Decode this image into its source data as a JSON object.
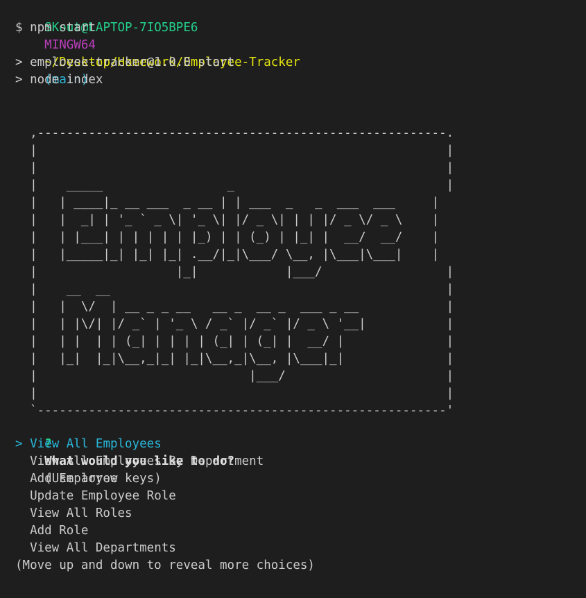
{
  "prompt": {
    "user_host": "SKout@LAPTOP-7IO5BPE6",
    "shell": "MINGW64",
    "path": "~/Desktop/Homework/Employee-Tracker",
    "branch": "(main)",
    "symbol": "$",
    "command": "npm start"
  },
  "npm_output": [
    "> employee-tracker@1.0.0 start",
    "> node index"
  ],
  "banner_art": "  ,--------------------------------------------------------.\n  |                                                        |\n  |                                                        |\n  |    _____                 _                             |\n  |   | ____|_ __ ___  _ __ | | ___  _   _  ___  ___     |\n  |   |  _| | '_ ` _ \\| '_ \\| |/ _ \\| | | |/ _ \\/ _ \\    |\n  |   | |___| | | | | | |_) | | (_) | |_| |  __/  __/    |\n  |   |_____|_| |_| |_| .__/|_|\\___/ \\__, |\\___|\\___|    |\n  |                   |_|            |___/                 |\n  |    __  __                                              |\n  |   |  \\/  | __ _ _ __   __ _  __ _  ___ _ __            |\n  |   | |\\/| |/ _` | '_ \\ / _` |/ _` |/ _ \\ '__|           |\n  |   | |  | | (_| | | | | (_| | (_| |  __/ |              |\n  |   |_|  |_|\\__,_|_| |_|\\__,_|\\__, |\\___|_|              |\n  |                             |___/                      |\n  |                                                        |\n  `--------------------------------------------------------'",
  "menu": {
    "qmark": "?",
    "question": "What would you like to do?",
    "hint": "(Use arrow keys)",
    "pointer": ">",
    "choices": [
      "View All Employees",
      "View All Employees By Department",
      "Add Employee",
      "Update Employee Role",
      "View All Roles",
      "Add Role",
      "View All Departments"
    ],
    "footer": "(Move up and down to reveal more choices)"
  }
}
